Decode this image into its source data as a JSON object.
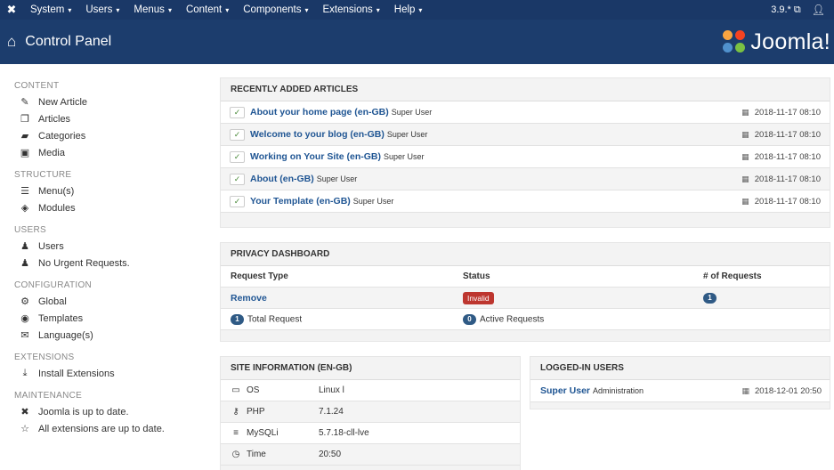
{
  "topnav": {
    "menus": [
      {
        "label": "System",
        "name": "menu-system"
      },
      {
        "label": "Users",
        "name": "menu-users"
      },
      {
        "label": "Menus",
        "name": "menu-menus"
      },
      {
        "label": "Content",
        "name": "menu-content"
      },
      {
        "label": "Components",
        "name": "menu-components"
      },
      {
        "label": "Extensions",
        "name": "menu-extensions"
      },
      {
        "label": "Help",
        "name": "menu-help"
      }
    ],
    "version": "3.9.*",
    "caret": "▾"
  },
  "header": {
    "title": "Control Panel",
    "brand": "Joomla!"
  },
  "sidebar": {
    "content_heading": "CONTENT",
    "content_items": [
      "New Article",
      "Articles",
      "Categories",
      "Media"
    ],
    "structure_heading": "STRUCTURE",
    "structure_items": [
      "Menu(s)",
      "Modules"
    ],
    "users_heading": "USERS",
    "users_items": [
      "Users",
      "No Urgent Requests."
    ],
    "configuration_heading": "CONFIGURATION",
    "configuration_items": [
      "Global",
      "Templates",
      "Language(s)"
    ],
    "extensions_heading": "EXTENSIONS",
    "extensions_items": [
      "Install Extensions"
    ],
    "maintenance_heading": "MAINTENANCE",
    "maintenance_items": [
      "Joomla is up to date.",
      "All extensions are up to date."
    ]
  },
  "recent_articles": {
    "title": "RECENTLY ADDED ARTICLES",
    "rows": [
      {
        "title": "About your home page (en-GB)",
        "author": "Super User",
        "date": "2018-11-17 08:10"
      },
      {
        "title": "Welcome to your blog (en-GB)",
        "author": "Super User",
        "date": "2018-11-17 08:10"
      },
      {
        "title": "Working on Your Site (en-GB)",
        "author": "Super User",
        "date": "2018-11-17 08:10"
      },
      {
        "title": "About (en-GB)",
        "author": "Super User",
        "date": "2018-11-17 08:10"
      },
      {
        "title": "Your Template (en-GB)",
        "author": "Super User",
        "date": "2018-11-17 08:10"
      }
    ]
  },
  "privacy": {
    "title": "PRIVACY DASHBOARD",
    "col_type": "Request Type",
    "col_status": "Status",
    "col_count": "# of Requests",
    "row_type": "Remove",
    "row_status": "Invalid",
    "row_count": "1",
    "total_count": "1",
    "total_label": "Total Request",
    "active_count": "0",
    "active_label": "Active Requests"
  },
  "site_info": {
    "title": "SITE INFORMATION (EN-GB)",
    "rows": [
      {
        "key": "OS",
        "value": "Linux l"
      },
      {
        "key": "PHP",
        "value": "7.1.24"
      },
      {
        "key": "MySQLi",
        "value": "5.7.18-cll-lve"
      },
      {
        "key": "Time",
        "value": "20:50"
      }
    ]
  },
  "logged_in": {
    "title": "LOGGED-IN USERS",
    "user": "Super User",
    "role": "Administration",
    "date": "2018-12-01 20:50"
  },
  "colors": {
    "nav_bg": "#1a3867",
    "header_bg": "#1c3d6d",
    "link": "#1f5593",
    "invalid": "#bd362f",
    "badge": "#2f5a85"
  }
}
